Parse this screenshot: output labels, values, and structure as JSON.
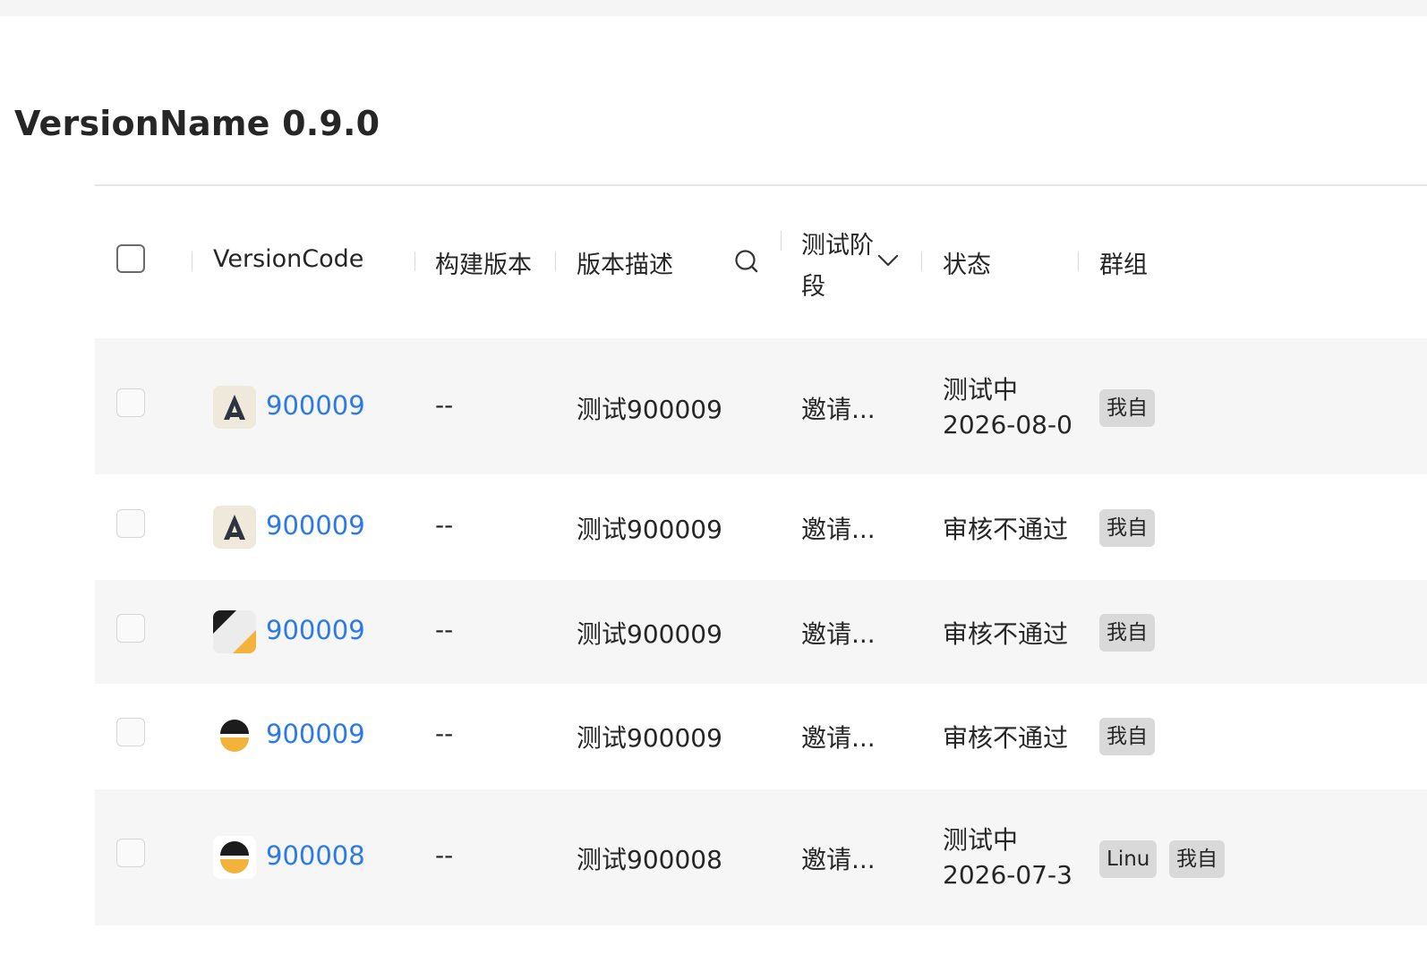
{
  "page": {
    "title": "VersionName 0.9.0"
  },
  "table": {
    "columns": {
      "version_code": "VersionCode",
      "build_version": "构建版本",
      "description": "版本描述",
      "test_stage_line1": "测试阶",
      "test_stage_line2": "段",
      "status": "状态",
      "group": "群组"
    },
    "rows": [
      {
        "icon": "letter-a-icon",
        "code": "900009",
        "build": "--",
        "desc": "测试900009",
        "stage": "邀请...",
        "status_line1": "测试中",
        "status_line2": "2026-08-0",
        "tags": [
          "我自"
        ]
      },
      {
        "icon": "letter-a-icon",
        "code": "900009",
        "build": "--",
        "desc": "测试900009",
        "stage": "邀请...",
        "status_line1": "审核不通过",
        "status_line2": "",
        "tags": [
          "我自"
        ]
      },
      {
        "icon": "diagonal-split-icon",
        "code": "900009",
        "build": "--",
        "desc": "测试900009",
        "stage": "邀请...",
        "status_line1": "审核不通过",
        "status_line2": "",
        "tags": [
          "我自"
        ]
      },
      {
        "icon": "half-circle-icon",
        "code": "900009",
        "build": "--",
        "desc": "测试900009",
        "stage": "邀请...",
        "status_line1": "审核不通过",
        "status_line2": "",
        "tags": [
          "我自"
        ]
      },
      {
        "icon": "half-circle-icon",
        "code": "900008",
        "build": "--",
        "desc": "测试900008",
        "stage": "邀请...",
        "status_line1": "测试中",
        "status_line2": "2026-07-3",
        "tags": [
          "Linu",
          "我自"
        ]
      }
    ]
  },
  "colors": {
    "link": "#2b7ae8",
    "row_alt": "#f6f6f6",
    "tag_bg": "#d9d9d9",
    "icon_yellow": "#f2b23b"
  }
}
